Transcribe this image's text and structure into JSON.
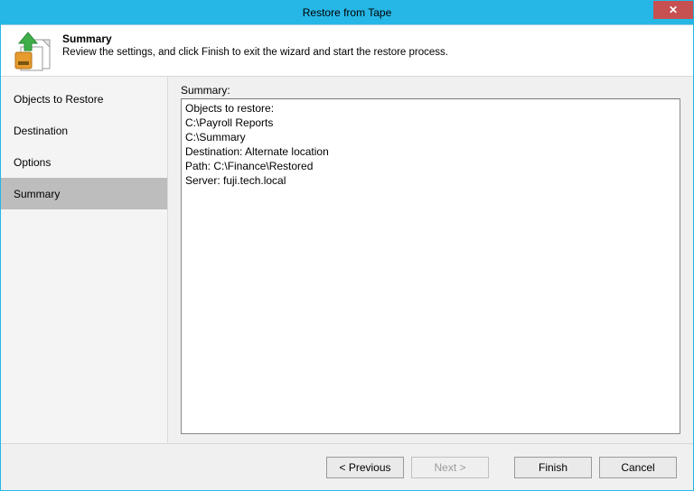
{
  "window": {
    "title": "Restore from Tape"
  },
  "header": {
    "title": "Summary",
    "subtitle": "Review the settings, and click Finish to exit the wizard and start the restore process."
  },
  "nav": {
    "items": [
      {
        "label": "Objects to Restore"
      },
      {
        "label": "Destination"
      },
      {
        "label": "Options"
      },
      {
        "label": "Summary"
      }
    ],
    "selectedIndex": 3
  },
  "content": {
    "summaryLabel": "Summary:",
    "summaryText": "Objects to restore:\nC:\\Payroll Reports\nC:\\Summary\nDestination: Alternate location\nPath: C:\\Finance\\Restored\nServer: fuji.tech.local"
  },
  "footer": {
    "previous": "< Previous",
    "next": "Next >",
    "finish": "Finish",
    "cancel": "Cancel"
  }
}
